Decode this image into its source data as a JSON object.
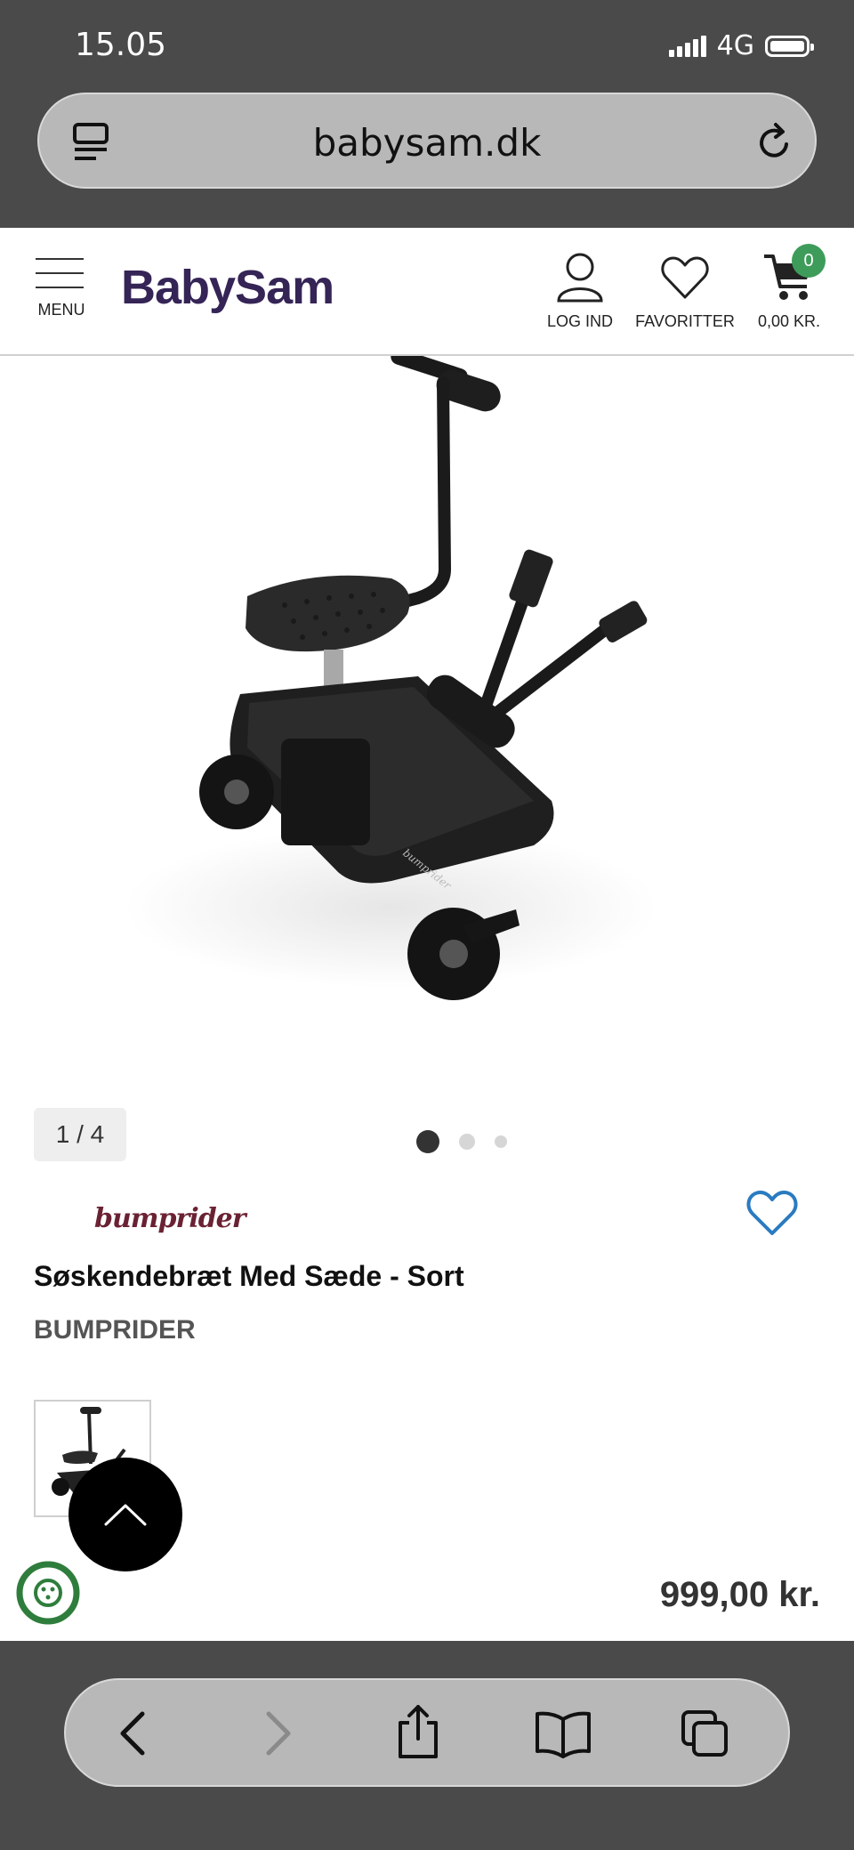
{
  "status_bar": {
    "time": "15.05",
    "network": "4G"
  },
  "browser": {
    "url": "babysam.dk"
  },
  "header": {
    "logo": "BabySam",
    "menu_label": "MENU",
    "login_label": "LOG IND",
    "favorites_label": "FAVORITTER",
    "cart_total": "0,00 KR.",
    "cart_count": "0"
  },
  "gallery": {
    "counter": "1 / 4",
    "dots": [
      {
        "active": true
      },
      {
        "active": false
      },
      {
        "active": false
      }
    ]
  },
  "product": {
    "brand_logo": "bumprider",
    "title": "Søskendebræt Med Sæde - Sort",
    "brand": "BUMPRIDER",
    "price": "999,00 kr."
  },
  "colors": {
    "brand_purple": "#352456",
    "cart_badge_green": "#3e9c5a",
    "heart_blue": "#2a7bc0",
    "chrome_gray": "#4a4a4a"
  },
  "icons": [
    "reader-icon",
    "reload-icon",
    "menu-icon",
    "user-icon",
    "heart-icon",
    "cart-icon",
    "chevron-up-icon",
    "eco-icon",
    "back-icon",
    "forward-icon",
    "share-icon",
    "bookmarks-icon",
    "tabs-icon"
  ]
}
